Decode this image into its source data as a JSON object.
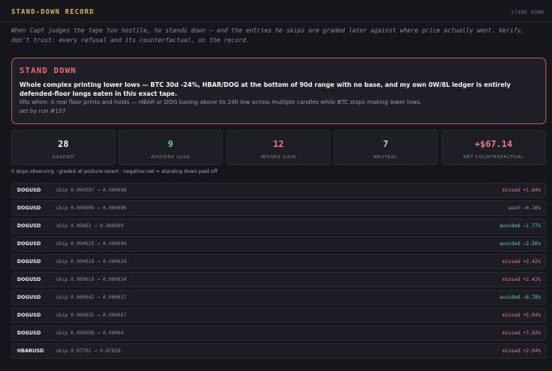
{
  "header": {
    "title": "STAND-DOWN RECORD",
    "corner_label": "STAND DOWN"
  },
  "intro": "When Capt judges the tape too hostile, he stands down — and the entries he skips are graded later against where price actually went. Verify, don't trust: every refusal and its counterfactual, on the record.",
  "banner": {
    "title": "STAND DOWN",
    "description": "Whole complex printing lower lows — BTC 30d -24%, HBAR/DOG at the bottom of 90d range with no base, and my own 0W/8L ledger is entirely defended-floor longs eaten in this exact tape.",
    "lifts_when": "lifts when: A real floor prints and holds — HBAR or DOG basing above its 24h low across multiple candles while BTC stops making lower lows.",
    "set_by": "set by run #157"
  },
  "stats": [
    {
      "value": "28",
      "label": "GRADED",
      "color": "#f0f0f4"
    },
    {
      "value": "9",
      "label": "AVOIDED LOSS",
      "color": "#5fd3a8"
    },
    {
      "value": "12",
      "label": "MISSED GAIN",
      "color": "#ef7a85"
    },
    {
      "value": "7",
      "label": "NEUTRAL",
      "color": "#c6c6ce"
    },
    {
      "value": "+$67.14",
      "label": "NET COUNTERFACTUAL",
      "color": "#ef7a85"
    }
  ],
  "summary": "0 skips observing · graded at posture-revert · negative net = standing down paid off",
  "rows": [
    {
      "symbol": "DOGUSD",
      "range": "skip 0.000597 → 0.000608",
      "result": "missed +1.84%",
      "color": "#ef7a85"
    },
    {
      "symbol": "DOGUSD",
      "range": "skip 0.000609 → 0.000608",
      "result": "wash −0.16%",
      "color": "#9a9aa5"
    },
    {
      "symbol": "DOGUSD",
      "range": "skip 0.00062 → 0.000609",
      "result": "avoided −1.77%",
      "color": "#5fd3a8"
    },
    {
      "symbol": "DOGUSD",
      "range": "skip 0.000625 → 0.000609",
      "result": "avoided −2.56%",
      "color": "#5fd3a8"
    },
    {
      "symbol": "DOGUSD",
      "range": "skip 0.000619 → 0.000634",
      "result": "missed +2.42%",
      "color": "#ef7a85"
    },
    {
      "symbol": "DOGUSD",
      "range": "skip 0.000619 → 0.000634",
      "result": "missed +2.42%",
      "color": "#ef7a85"
    },
    {
      "symbol": "DOGUSD",
      "range": "skip 0.000642 → 0.000637",
      "result": "avoided −0.78%",
      "color": "#5fd3a8"
    },
    {
      "symbol": "DOGUSD",
      "range": "skip 0.000635 → 0.000667",
      "result": "missed +5.04%",
      "color": "#ef7a85"
    },
    {
      "symbol": "DOGUSD",
      "range": "skip 0.000598 → 0.00064",
      "result": "missed +7.02%",
      "color": "#ef7a85"
    },
    {
      "symbol": "HBARUSD",
      "range": "skip 0.07701 → 0.07858",
      "result": "missed +2.04%",
      "color": "#ef7a85"
    }
  ]
}
